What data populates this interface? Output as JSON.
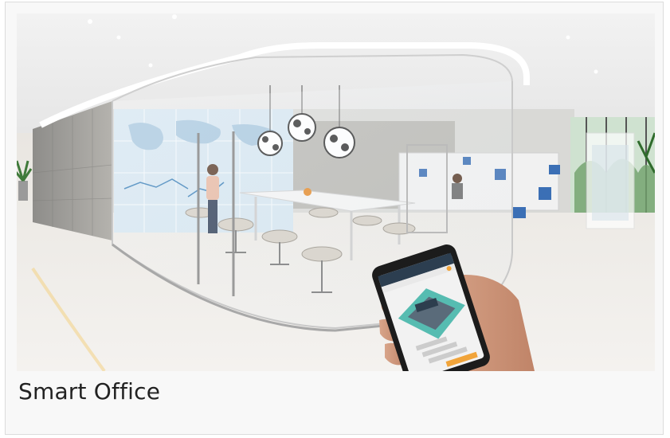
{
  "card": {
    "caption": "Smart Office"
  },
  "colors": {
    "caption_text": "#222222",
    "card_bg": "#f8f8f8",
    "accent_blue": "#3b6fb5",
    "phone_screen_accent": "#3bb3a6"
  }
}
